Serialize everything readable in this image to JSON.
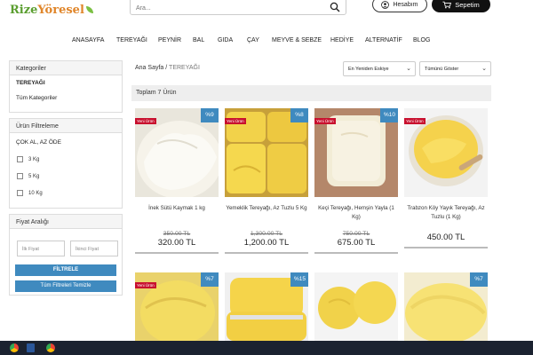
{
  "header": {
    "logo_part1": "Rize",
    "logo_part2": "Yöresel",
    "search_placeholder": "Ara...",
    "account_label": "Hesabım",
    "cart_label": "Sepetim",
    "cart_count": "0"
  },
  "nav": [
    "ANASAYFA",
    "TEREYAĞI",
    "PEYNİR",
    "BAL",
    "GIDA",
    "ÇAY",
    "MEYVE & SEBZE",
    "HEDİYE",
    "ALTERNATİF",
    "BLOG"
  ],
  "sidebar": {
    "categories_title": "Kategoriler",
    "categories": [
      "TEREYAĞI",
      "Tüm Kategoriler"
    ],
    "filter_title": "Ürün Filtreleme",
    "filter_group": "ÇOK AL, AZ ÖDE",
    "options": [
      "3 Kg",
      "5 Kg",
      "10 Kg"
    ],
    "price_title": "Fiyat Aralığı",
    "min_placeholder": "İlk Fiyat",
    "max_placeholder": "İkinci Fiyat",
    "filter_button": "FİLTRELE",
    "clear_button": "Tüm Filtreleri Temizle"
  },
  "breadcrumb": {
    "home": "Ana Sayfa",
    "sep": "/",
    "current": "TEREYAĞI"
  },
  "sort": {
    "order": "En Yeniden Eskiye",
    "show": "Tümünü Göster"
  },
  "total": "Toplam 7 Ürün",
  "products": [
    {
      "new": "Yeni Ürün",
      "discount": "%9",
      "name": "İnek Sütü Kaymak 1 kg",
      "old_price": "350.00 TL",
      "price": "320.00 TL"
    },
    {
      "new": "Yeni Ürün",
      "discount": "%8",
      "name": "Yemeklik Tereyağı, Az Tuzlu 5 Kg",
      "old_price": "1,300.00 TL",
      "price": "1,200.00 TL"
    },
    {
      "new": "Yeni Ürün",
      "discount": "%10",
      "name": "Keçi Tereyağı, Hemşin Yayla (1 Kg)",
      "old_price": "750.00 TL",
      "price": "675.00 TL"
    },
    {
      "new": "Yeni Ürün",
      "discount": "",
      "name": "Trabzon Köy Yayık Tereyağı, Az Tuzlu (1 Kg)",
      "old_price": "",
      "price": "450.00 TL"
    },
    {
      "new": "Yeni Ürün",
      "discount": "%7"
    },
    {
      "new": "",
      "discount": "%15"
    },
    {
      "new": "",
      "discount": ""
    },
    {
      "new": "",
      "discount": "%7"
    }
  ],
  "colors": {
    "accent": "#3f8abf",
    "new_badge": "#c8102e",
    "logo_green": "#5a9e2f",
    "logo_orange": "#e0862b"
  }
}
